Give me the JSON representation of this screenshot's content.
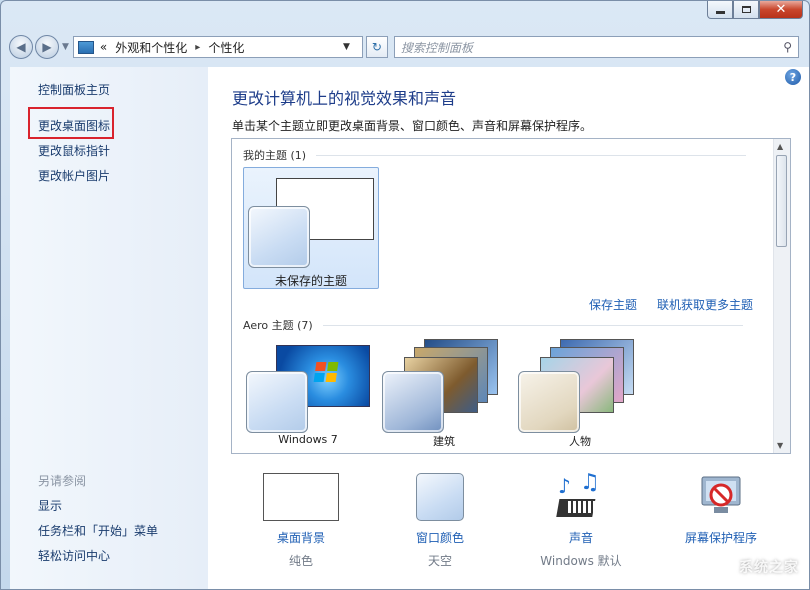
{
  "window": {
    "controls": {
      "minimize": "minimize",
      "maximize": "maximize",
      "close": "✕"
    }
  },
  "navbar": {
    "breadcrumb_prefix": "«",
    "breadcrumb": [
      "外观和个性化",
      "个性化"
    ],
    "separator": "▸",
    "search_placeholder": "搜索控制面板"
  },
  "sidebar": {
    "home": "控制面板主页",
    "links": [
      "更改桌面图标",
      "更改鼠标指针",
      "更改帐户图片"
    ],
    "see_also_title": "另请参阅",
    "see_also": [
      "显示",
      "任务栏和「开始」菜单",
      "轻松访问中心"
    ]
  },
  "main": {
    "help": "?",
    "title": "更改计算机上的视觉效果和声音",
    "subtitle": "单击某个主题立即更改桌面背景、窗口颜色、声音和屏幕保护程序。",
    "my_themes_header": "我的主题 (1)",
    "unsaved_theme_label": "未保存的主题",
    "save_theme_link": "保存主题",
    "online_themes_link": "联机获取更多主题",
    "aero_header": "Aero 主题 (7)",
    "aero_themes": [
      "Windows 7",
      "建筑",
      "人物"
    ]
  },
  "settings": [
    {
      "label": "桌面背景",
      "value": "纯色"
    },
    {
      "label": "窗口颜色",
      "value": "天空"
    },
    {
      "label": "声音",
      "value": "Windows 默认"
    },
    {
      "label": "屏幕保护程序",
      "value": ""
    }
  ],
  "watermark": "系统之家",
  "colors": {
    "link": "#1f5fb4",
    "title": "#1e3d8a",
    "highlight": "#d9232d"
  }
}
